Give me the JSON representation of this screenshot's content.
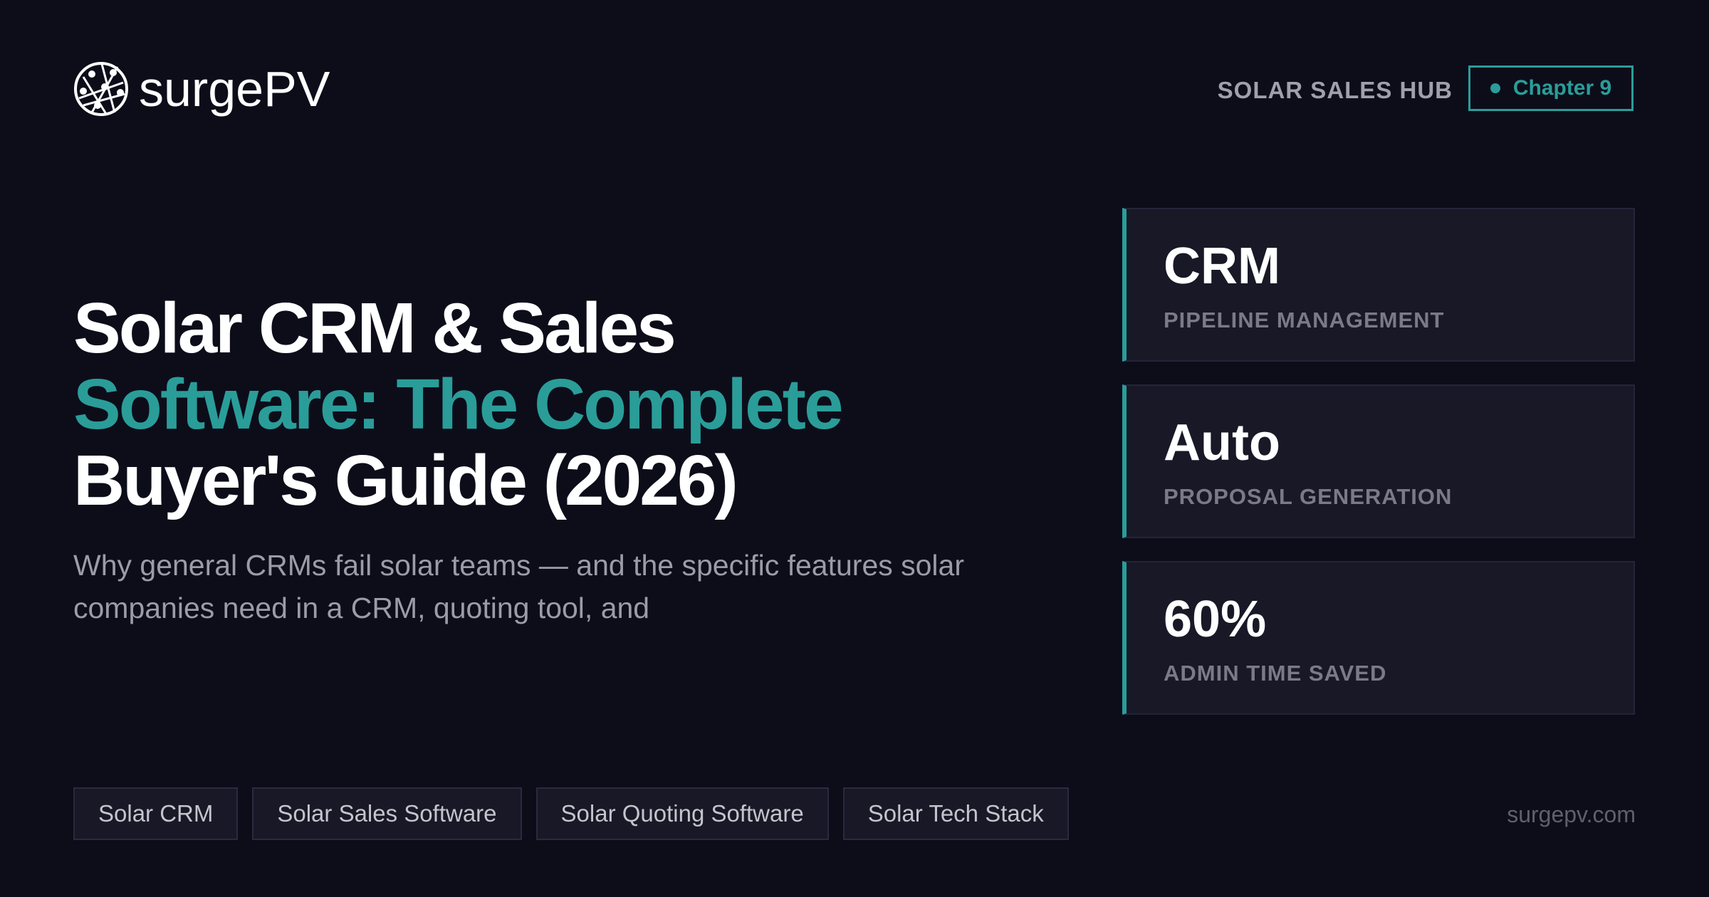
{
  "brand": {
    "name": "surgePV"
  },
  "header": {
    "hub_label": "SOLAR SALES HUB",
    "chapter_label": "Chapter 9"
  },
  "headline": {
    "line1": "Solar CRM & Sales",
    "line2": "Software: The Complete",
    "line3": "Buyer's Guide (2026)"
  },
  "subtitle": "Why general CRMs fail solar teams — and the specific features solar companies need in a CRM, quoting tool, and",
  "stats": [
    {
      "value": "CRM",
      "label": "PIPELINE MANAGEMENT"
    },
    {
      "value": "Auto",
      "label": "PROPOSAL GENERATION"
    },
    {
      "value": "60%",
      "label": "ADMIN TIME SAVED"
    }
  ],
  "tags": [
    "Solar CRM",
    "Solar Sales Software",
    "Solar Quoting Software",
    "Solar Tech Stack"
  ],
  "footer": {
    "site": "surgepv.com"
  },
  "colors": {
    "accent": "#2a9d99",
    "background": "#0d0d1a",
    "card": "#181827"
  }
}
